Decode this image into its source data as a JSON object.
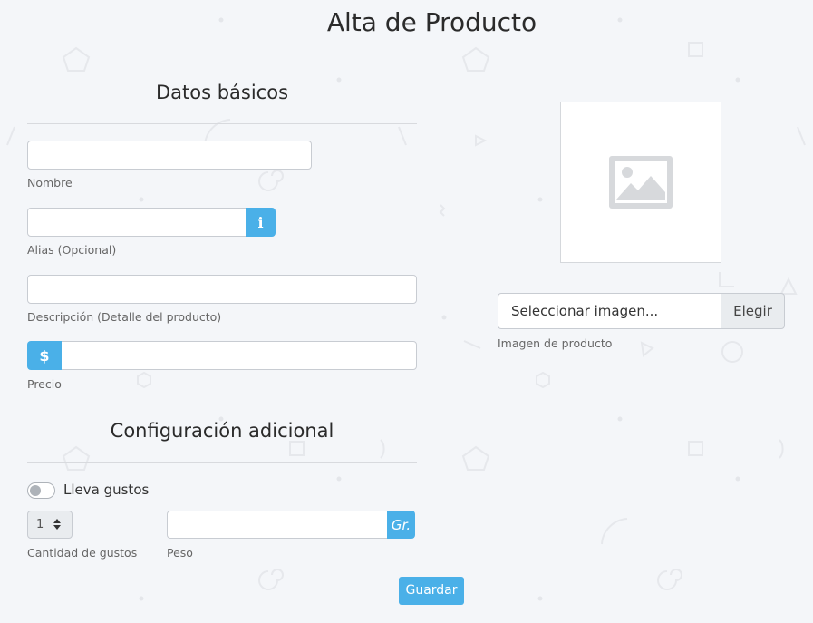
{
  "page": {
    "title": "Alta de Producto"
  },
  "basic": {
    "section_title": "Datos básicos",
    "name_label": "Nombre",
    "alias_label": "Alias (Opcional)",
    "alias_info_icon": "info-icon",
    "description_label": "Descripción (Detalle del producto)",
    "price_label": "Precio",
    "price_icon": "dollar-icon",
    "price_symbol": "$",
    "info_symbol": "i"
  },
  "image": {
    "placeholder_icon": "image-placeholder-icon",
    "file_text": "Seleccionar imagen...",
    "file_button": "Elegir",
    "label": "Imagen de producto"
  },
  "config": {
    "section_title": "Configuración adicional",
    "toggle_label": "Lleva gustos",
    "toggle_on": false,
    "flavors_value": "1",
    "flavors_label": "Cantidad de gustos",
    "weight_label": "Peso",
    "weight_unit": "Gr."
  },
  "actions": {
    "save_label": "Guardar"
  },
  "colors": {
    "accent": "#4ab0e8",
    "background": "#f4f6f9"
  }
}
